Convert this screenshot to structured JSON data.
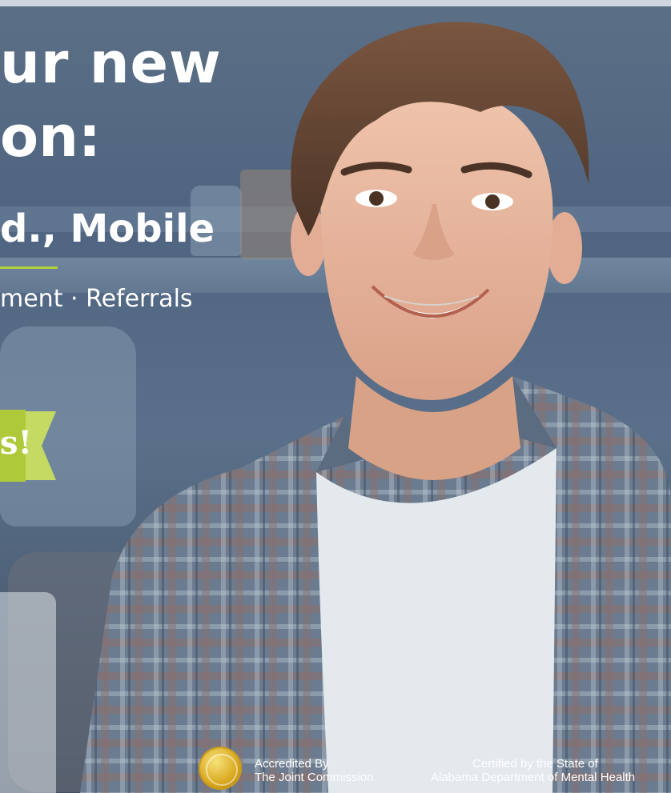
{
  "headline": {
    "line1": "ur new",
    "line2": "on:",
    "line3": "d., Mobile",
    "line4": "ment · Referrals"
  },
  "ribbon": {
    "text": "s!"
  },
  "badges": {
    "accredited_line1": "Accredited By",
    "accredited_line2": "The Joint Commission",
    "certified_line1": "Certified by the State of",
    "certified_line2": "Alabama Department of Mental Health"
  },
  "colors": {
    "accent_green": "#aec93a",
    "background_blue": "#4f6480",
    "text": "#ffffff",
    "seal_gold": "#d7a51a"
  },
  "icons": {
    "seal": "gold-seal-icon"
  }
}
